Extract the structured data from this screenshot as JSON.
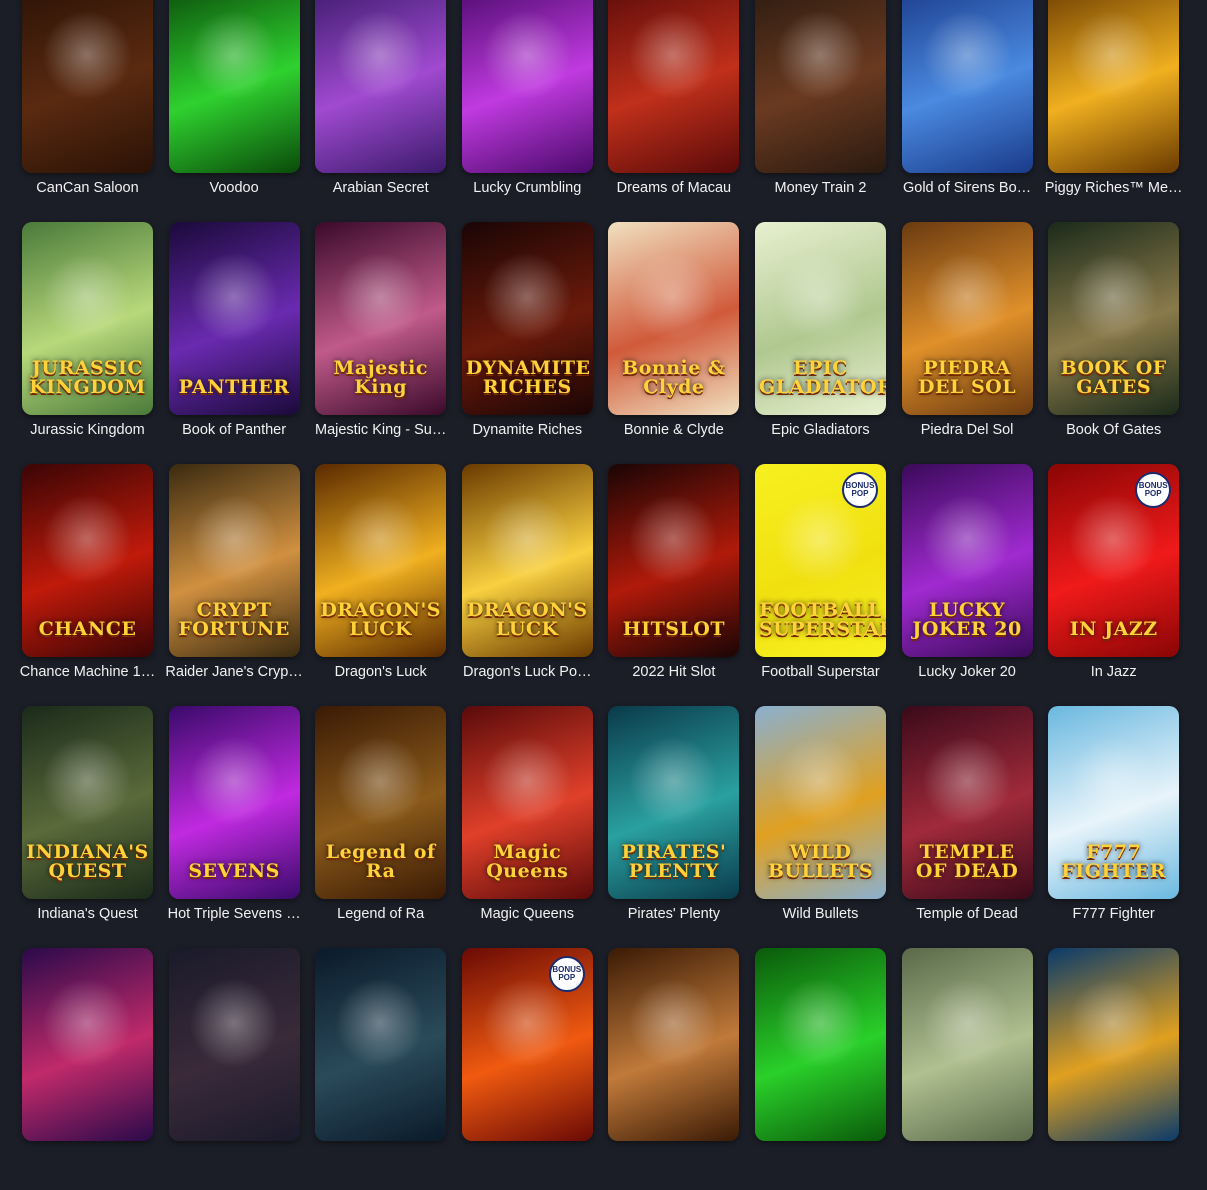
{
  "games": [
    {
      "name": "CanCan Saloon",
      "logo": "",
      "colors": [
        "#2a1206",
        "#5a2a10"
      ],
      "badge": ""
    },
    {
      "name": "Voodoo",
      "logo": "",
      "colors": [
        "#0a4a0a",
        "#2fd12f"
      ],
      "badge": ""
    },
    {
      "name": "Arabian Secret",
      "logo": "",
      "colors": [
        "#3a1a6a",
        "#a04ad0"
      ],
      "badge": ""
    },
    {
      "name": "Lucky Crumbling",
      "logo": "",
      "colors": [
        "#4a0a6a",
        "#c03ae0"
      ],
      "badge": ""
    },
    {
      "name": "Dreams of Macau",
      "logo": "",
      "colors": [
        "#5a0a0a",
        "#c0301a"
      ],
      "badge": ""
    },
    {
      "name": "Money Train 2",
      "logo": "",
      "colors": [
        "#2a1a10",
        "#6a3a20"
      ],
      "badge": ""
    },
    {
      "name": "Gold of Sirens Bo…",
      "logo": "",
      "colors": [
        "#1a3a8a",
        "#4a8ae0"
      ],
      "badge": ""
    },
    {
      "name": "Piggy Riches™ Me…",
      "logo": "",
      "colors": [
        "#6a3a00",
        "#f0b020"
      ],
      "badge": ""
    },
    {
      "name": "Jurassic Kingdom",
      "logo": "JURASSIC KINGDOM",
      "colors": [
        "#4a7a3a",
        "#b8d87a"
      ],
      "badge": ""
    },
    {
      "name": "Book of Panther",
      "logo": "PANTHER",
      "colors": [
        "#1a0a3a",
        "#6a2ab0"
      ],
      "badge": ""
    },
    {
      "name": "Majestic King - Su…",
      "logo": "Majestic King",
      "colors": [
        "#3a0a2a",
        "#c05a8a"
      ],
      "badge": ""
    },
    {
      "name": "Dynamite Riches",
      "logo": "DYNAMITE RICHES",
      "colors": [
        "#1a0505",
        "#6a1a0a"
      ],
      "badge": ""
    },
    {
      "name": "Bonnie & Clyde",
      "logo": "Bonnie & Clyde",
      "colors": [
        "#f0e0c0",
        "#d05a3a"
      ],
      "badge": ""
    },
    {
      "name": "Epic Gladiators",
      "logo": "EPIC GLADIATORS",
      "colors": [
        "#e8f0d0",
        "#b0c890"
      ],
      "badge": ""
    },
    {
      "name": "Piedra Del Sol",
      "logo": "PIEDRA DEL SOL",
      "colors": [
        "#6a3a10",
        "#e0902a"
      ],
      "badge": ""
    },
    {
      "name": "Book Of Gates",
      "logo": "BOOK OF GATES",
      "colors": [
        "#1a2a1a",
        "#8a7a4a"
      ],
      "badge": ""
    },
    {
      "name": "Chance Machine 1…",
      "logo": "CHANCE",
      "colors": [
        "#3a0505",
        "#c01a0a"
      ],
      "badge": ""
    },
    {
      "name": "Raider Jane's Cryp…",
      "logo": "CRYPT FORTUNE",
      "colors": [
        "#3a2a10",
        "#d09040"
      ],
      "badge": ""
    },
    {
      "name": "Dragon's Luck",
      "logo": "DRAGON'S LUCK",
      "colors": [
        "#5a2a00",
        "#f0b020"
      ],
      "badge": ""
    },
    {
      "name": "Dragon's Luck Po…",
      "logo": "DRAGON'S LUCK",
      "colors": [
        "#6a3a00",
        "#f8d040"
      ],
      "badge": ""
    },
    {
      "name": "2022 Hit Slot",
      "logo": "HITSLOT",
      "colors": [
        "#1a0505",
        "#b01a0a"
      ],
      "badge": ""
    },
    {
      "name": "Football Superstar",
      "logo": "FOOTBALL SUPERSTAR",
      "colors": [
        "#f8f020",
        "#f0e010"
      ],
      "badge": "BONUS POP"
    },
    {
      "name": "Lucky Joker 20",
      "logo": "LUCKY JOKER 20",
      "colors": [
        "#3a0a5a",
        "#a02ad0"
      ],
      "badge": ""
    },
    {
      "name": "In Jazz",
      "logo": "IN JAZZ",
      "colors": [
        "#8a0505",
        "#f01a1a"
      ],
      "badge": "BONUS POP"
    },
    {
      "name": "Indiana's Quest",
      "logo": "INDIANA'S QUEST",
      "colors": [
        "#1a2a1a",
        "#5a6a3a"
      ],
      "badge": ""
    },
    {
      "name": "Hot Triple Sevens …",
      "logo": "SEVENS",
      "colors": [
        "#3a0a6a",
        "#c02ae0"
      ],
      "badge": ""
    },
    {
      "name": "Legend of Ra",
      "logo": "Legend of Ra",
      "colors": [
        "#3a1a05",
        "#8a5a1a"
      ],
      "badge": ""
    },
    {
      "name": "Magic Queens",
      "logo": "Magic Queens",
      "colors": [
        "#5a0a0a",
        "#e0402a"
      ],
      "badge": ""
    },
    {
      "name": "Pirates' Plenty",
      "logo": "PIRATES' PLENTY",
      "colors": [
        "#0a3a4a",
        "#2aa0a0"
      ],
      "badge": ""
    },
    {
      "name": "Wild Bullets",
      "logo": "WILD BULLETS",
      "colors": [
        "#8ab0d0",
        "#e0a020"
      ],
      "badge": ""
    },
    {
      "name": "Temple of Dead",
      "logo": "TEMPLE OF DEAD",
      "colors": [
        "#3a0a1a",
        "#a02a3a"
      ],
      "badge": ""
    },
    {
      "name": "F777 Fighter",
      "logo": "F777 FIGHTER",
      "colors": [
        "#6ab8e0",
        "#e8f4fa"
      ],
      "badge": ""
    },
    {
      "name": "",
      "logo": "",
      "colors": [
        "#2a0a4a",
        "#c02a6a"
      ],
      "badge": ""
    },
    {
      "name": "",
      "logo": "",
      "colors": [
        "#1a1a2a",
        "#3a2a3a"
      ],
      "badge": ""
    },
    {
      "name": "",
      "logo": "",
      "colors": [
        "#0a1a2a",
        "#2a4a5a"
      ],
      "badge": ""
    },
    {
      "name": "",
      "logo": "",
      "colors": [
        "#6a0a05",
        "#f05a10"
      ],
      "badge": "BONUS POP"
    },
    {
      "name": "",
      "logo": "",
      "colors": [
        "#3a1a05",
        "#c07a3a"
      ],
      "badge": ""
    },
    {
      "name": "",
      "logo": "",
      "colors": [
        "#0a5a0a",
        "#2ad02a"
      ],
      "badge": ""
    },
    {
      "name": "",
      "logo": "",
      "colors": [
        "#5a6a4a",
        "#b0c090"
      ],
      "badge": ""
    },
    {
      "name": "",
      "logo": "",
      "colors": [
        "#0a3a6a",
        "#e0a020"
      ],
      "badge": ""
    }
  ]
}
